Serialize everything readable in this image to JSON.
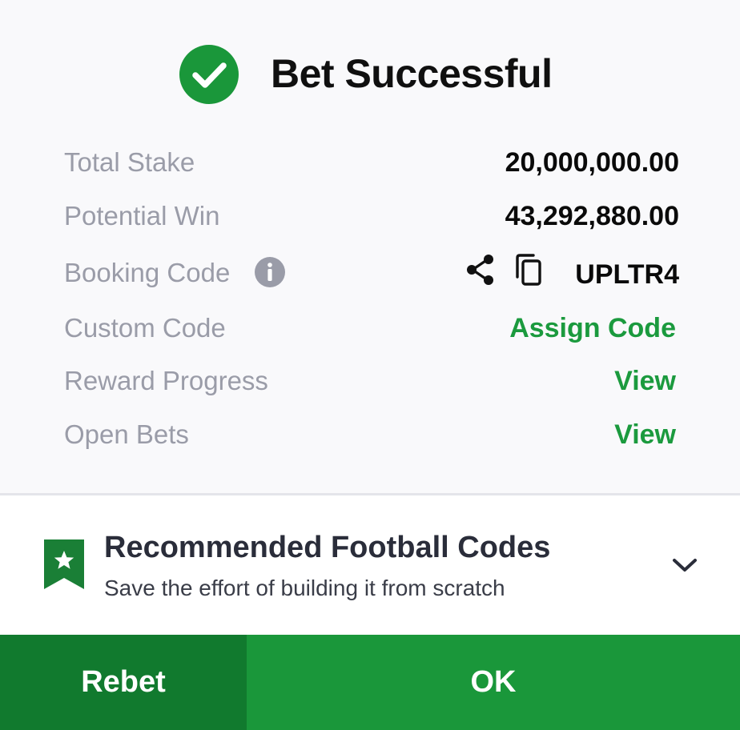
{
  "header": {
    "title": "Bet Successful",
    "icon": "check-circle-icon"
  },
  "details": {
    "total_stake": {
      "label": "Total Stake",
      "value": "20,000,000.00"
    },
    "potential_win": {
      "label": "Potential Win",
      "value": "43,292,880.00"
    },
    "booking_code": {
      "label": "Booking Code",
      "value": "UPLTR4",
      "icons": [
        "info-icon",
        "share-icon",
        "copy-icon"
      ]
    },
    "custom_code": {
      "label": "Custom Code",
      "action": "Assign Code"
    },
    "reward_progress": {
      "label": "Reward Progress",
      "action": "View"
    },
    "open_bets": {
      "label": "Open Bets",
      "action": "View"
    }
  },
  "recommended": {
    "title": "Recommended Football Codes",
    "subtitle": "Save the effort of building it from scratch",
    "icons": [
      "bookmark-star-icon",
      "chevron-down-icon"
    ]
  },
  "buttons": {
    "rebet": "Rebet",
    "ok": "OK"
  },
  "colors": {
    "accent_green": "#1b9a3e",
    "rebet_bg": "#117a2e",
    "ok_bg": "#1a973a",
    "label_gray": "#9a9ca8"
  }
}
